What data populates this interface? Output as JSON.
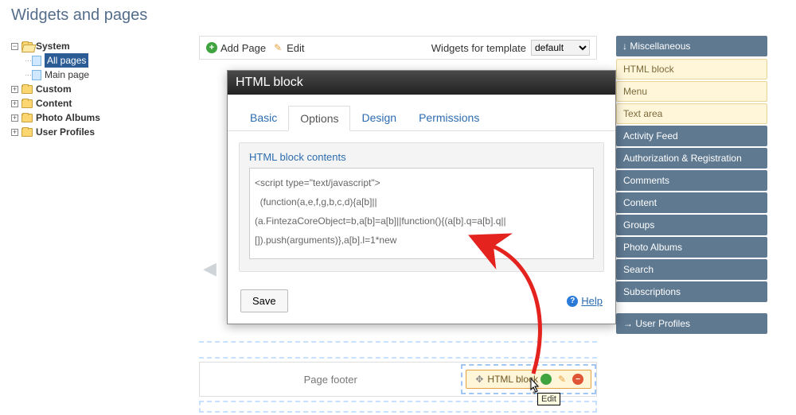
{
  "page_title": "Widgets and pages",
  "tree": {
    "system": "System",
    "all_pages": "All pages",
    "main_page": "Main page",
    "custom": "Custom",
    "content": "Content",
    "photo_albums": "Photo Albums",
    "user_profiles": "User Profiles"
  },
  "toolbar": {
    "add_page": "Add Page",
    "edit": "Edit",
    "widgets_for_template": "Widgets for template",
    "select_value": "default"
  },
  "footer": {
    "label": "Page footer",
    "chip_label": "HTML block"
  },
  "modal": {
    "title": "HTML block",
    "tabs": {
      "basic": "Basic",
      "options": "Options",
      "design": "Design",
      "permissions": "Permissions"
    },
    "field_label": "HTML block contents",
    "textarea_value": "<script type=\"text/javascript\">\n  (function(a,e,f,g,b,c,d){a[b]||\n(a.FintezaCoreObject=b,a[b]=a[b]||function(){(a[b].q=a[b].q||\n[]).push(arguments)},a[b].l=1*new",
    "save": "Save",
    "help": "Help"
  },
  "categories": {
    "misc_header": "↓ Miscellaneous",
    "html_block": "HTML block",
    "menu": "Menu",
    "text_area": "Text area",
    "activity_feed": "Activity Feed",
    "authorization": "Authorization & Registration",
    "comments": "Comments",
    "content": "Content",
    "groups": "Groups",
    "photo_albums": "Photo Albums",
    "search": "Search",
    "subscriptions": "Subscriptions",
    "user_profiles": "→ User Profiles"
  },
  "tooltip": "Edit"
}
